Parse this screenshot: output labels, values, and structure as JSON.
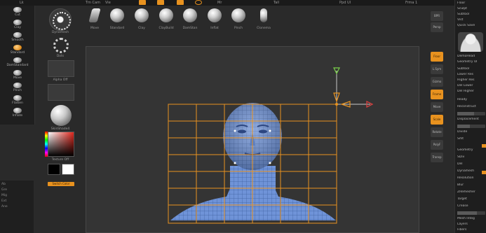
{
  "colors": {
    "accent": "#e8921f",
    "mesh_fill": "#6f93d8",
    "mesh_line": "#3a5a9a",
    "bbox": "#e8921f",
    "axis_y": "#7ad04a",
    "axis_z": "#e04040"
  },
  "topbar": {
    "items": [
      "Lk",
      "Tm Cam",
      "Vie",
      "Mr",
      "Tall",
      "Ppd UI",
      "Frma 1"
    ]
  },
  "left_sidebar": {
    "tools": [
      {
        "label": "Cut",
        "icon": "move-icon"
      },
      {
        "label": "Clay",
        "icon": "clay-brush-icon"
      },
      {
        "label": "Smooth",
        "icon": "smooth-brush-icon"
      },
      {
        "label": "Standard",
        "icon": "standard-brush-icon"
      },
      {
        "label": "DamStandard",
        "icon": "dam-standard-icon"
      },
      {
        "label": "Move",
        "icon": "move-brush-icon"
      },
      {
        "label": "Pinch",
        "icon": "pinch-brush-icon"
      },
      {
        "label": "Flatten",
        "icon": "flatten-brush-icon"
      },
      {
        "label": "Inflate",
        "icon": "inflate-brush-icon"
      }
    ],
    "bottom_items": [
      "Ab",
      "Gre",
      "Mig",
      "Ext",
      "Ane"
    ]
  },
  "tool_column": {
    "dial_label": "Dynamesh",
    "dots_label": "Dots",
    "alpha_label": "Alpha Off",
    "material_label": "SkinShade4",
    "texture_label": "Texture Off",
    "switch_label": "Switch Color"
  },
  "brushes": [
    {
      "label": "Move",
      "shape": "blade"
    },
    {
      "label": "Standard",
      "shape": "ball"
    },
    {
      "label": "Clay",
      "shape": "ball"
    },
    {
      "label": "ClayBuild",
      "shape": "ball"
    },
    {
      "label": "DamStan",
      "shape": "ball"
    },
    {
      "label": "Inflat",
      "shape": "ball"
    },
    {
      "label": "Pinch",
      "shape": "ball"
    },
    {
      "label": "Clonema",
      "shape": "cyl"
    }
  ],
  "right_col": {
    "items": [
      {
        "label": "BPR",
        "active": false
      },
      {
        "label": "Persp",
        "active": false
      },
      {
        "label": "Floor",
        "active": true
      },
      {
        "label": "L.Sym",
        "active": false
      },
      {
        "label": "Gizmo",
        "active": false
      },
      {
        "label": "Frame",
        "active": true
      },
      {
        "label": "Move",
        "active": false
      },
      {
        "label": "Scale",
        "active": true
      },
      {
        "label": "Rotate",
        "active": false
      },
      {
        "label": "PolyF",
        "active": false
      },
      {
        "label": "Transp",
        "active": false
      }
    ]
  },
  "right_panel": {
    "rows": [
      "Floor",
      "Sculpt",
      "Subtool",
      "Vist",
      "Quick Save",
      "Geometry UI",
      "Lower Res",
      "Higher Res",
      "Del Lower",
      "Del Higher",
      "Ready",
      "Reconstruct",
      "Displacement",
      "Divide",
      "Smt",
      "Geometry",
      "SDiv",
      "Del",
      "Dynamesh",
      "Resolution",
      "Blur",
      "ZRemesher",
      "Target",
      "Crease",
      "Mesh Integ",
      "Layers",
      "Fibers"
    ],
    "thumb_label": "DemoHead",
    "thumb_label2": "Subtool"
  }
}
